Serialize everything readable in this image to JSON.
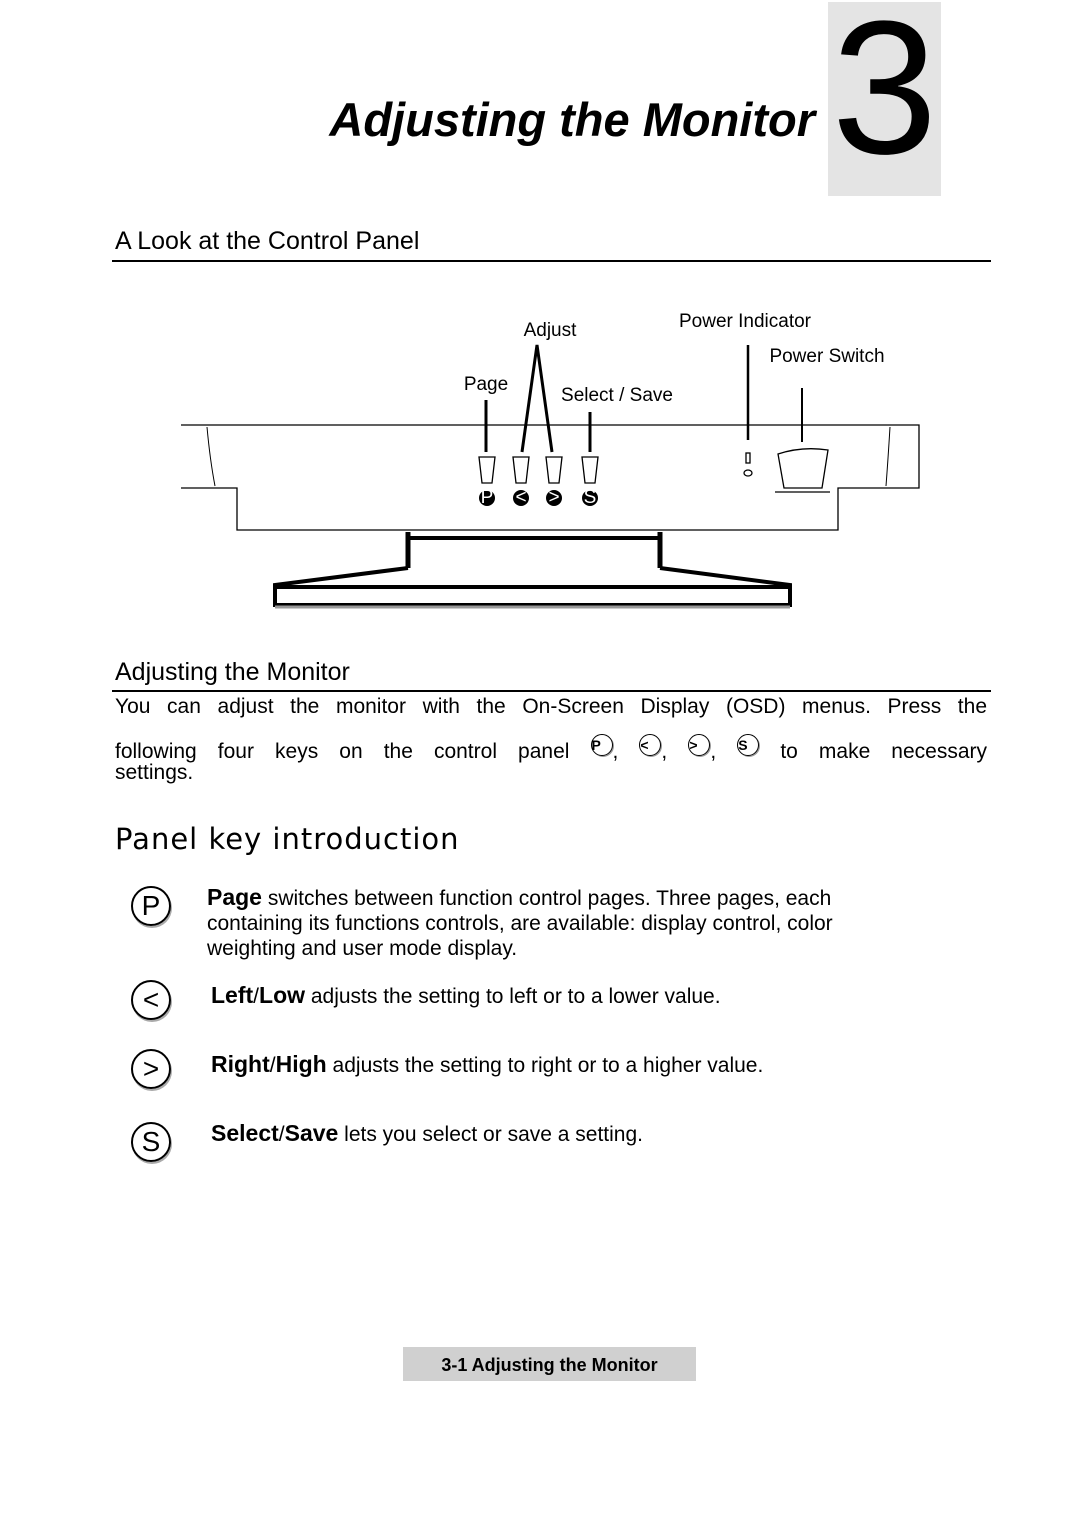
{
  "header": {
    "title": "Adjusting the Monitor",
    "chapter_number": "3"
  },
  "section1": {
    "heading": "A Look at the Control Panel"
  },
  "diagram": {
    "labels": {
      "adjust": "Adjust",
      "page": "Page",
      "select_save": "Select / Save",
      "power_indicator": "Power Indicator",
      "power_switch": "Power Switch"
    },
    "button_glyphs": [
      "P",
      "<",
      ">",
      "S"
    ]
  },
  "section2": {
    "heading": "Adjusting the Monitor",
    "line1": "You can adjust the monitor with the On-Screen Display (OSD) menus.  Press the",
    "line2_pre": "following four keys on the control panel",
    "line2_post": "to make necessary",
    "line3": "settings.",
    "key_glyphs": [
      "P",
      "<",
      ">",
      "S"
    ]
  },
  "section3": {
    "heading": "Panel key introduction",
    "keys": [
      {
        "glyph": "P",
        "name": "Page",
        "text": " switches between function control pages.  Three pages, each containing its functions controls, are available: display control, color weighting and user mode display."
      },
      {
        "glyph": "<",
        "name": "Left",
        "sep": "/",
        "name2": "Low",
        "text": " adjusts the setting to left or to a lower value."
      },
      {
        "glyph": ">",
        "name": "Right",
        "sep": "/",
        "name2": "High",
        "text": " adjusts the setting to right or to a higher value."
      },
      {
        "glyph": "S",
        "name": "Select",
        "sep": "/",
        "name2": "Save",
        "text": " lets you select or save a setting."
      }
    ]
  },
  "footer": {
    "page_label": "3-1 Adjusting the Monitor"
  }
}
